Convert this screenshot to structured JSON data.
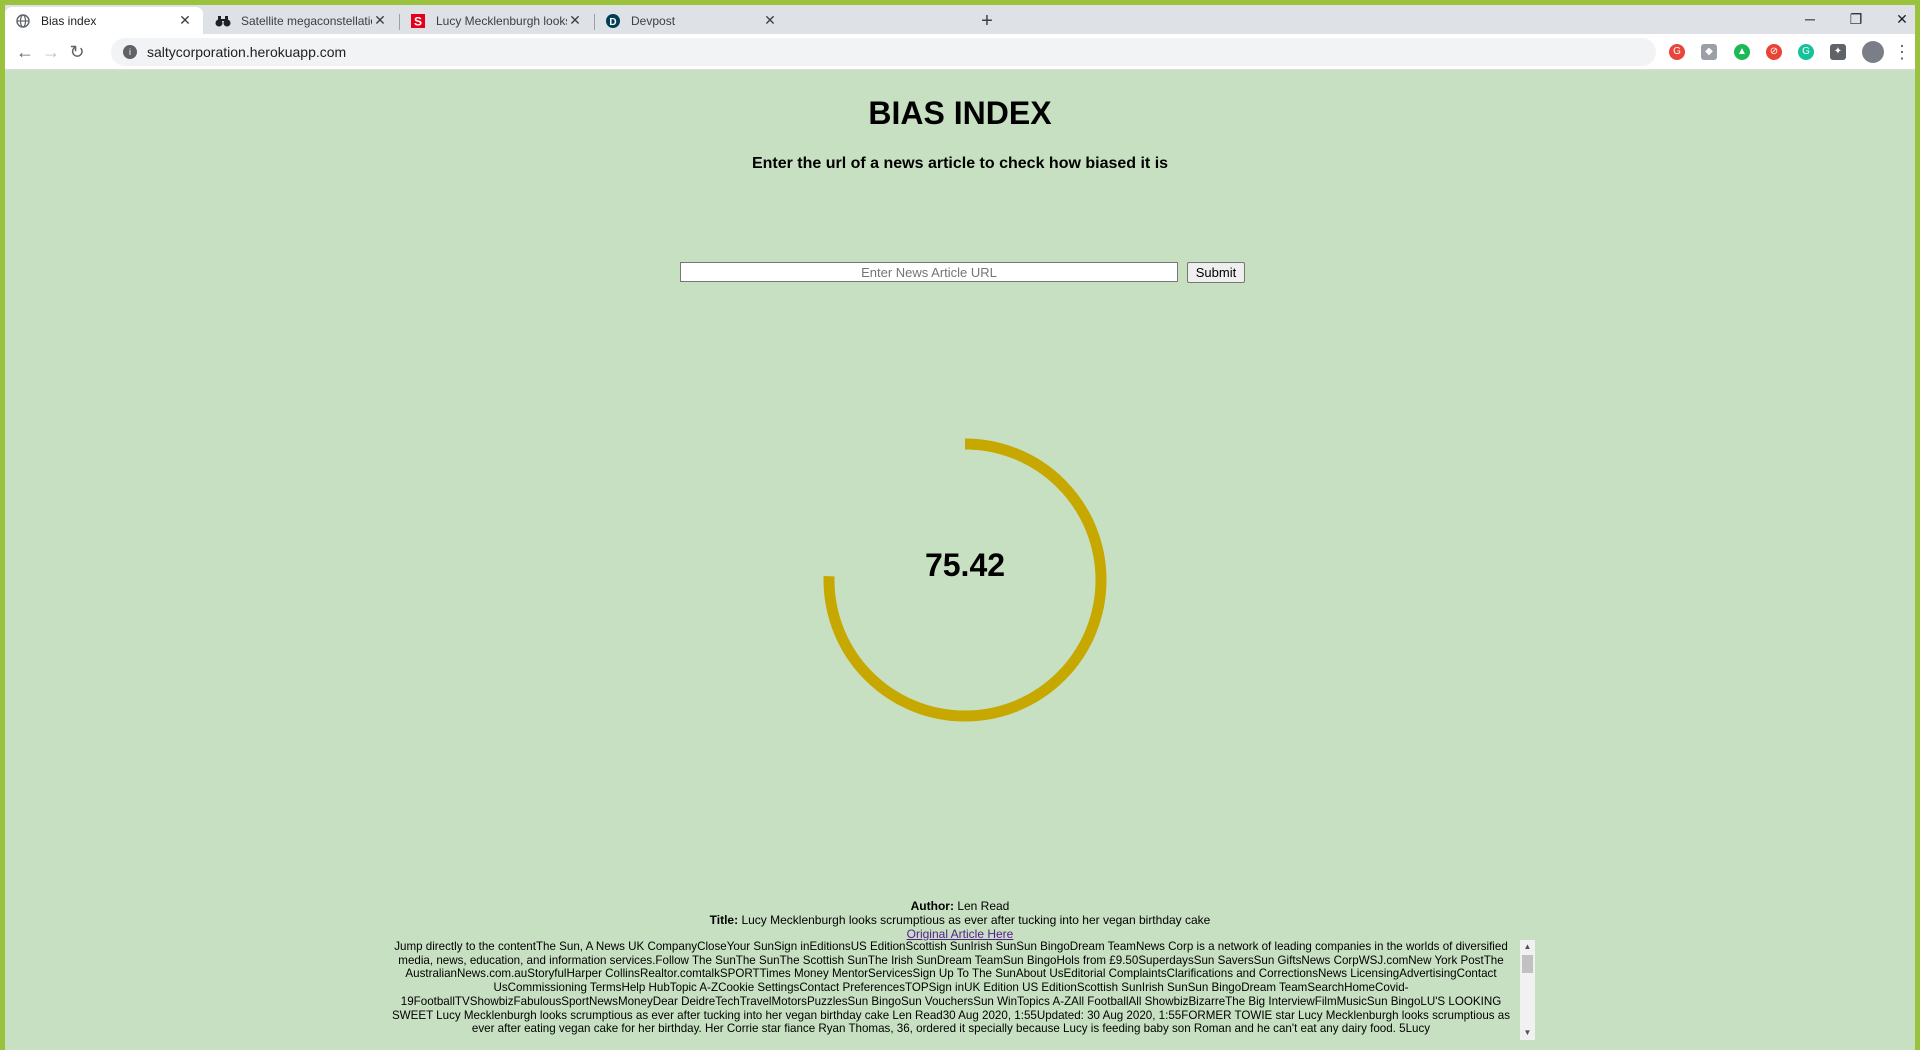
{
  "browser": {
    "tabs": [
      {
        "title": "Bias index",
        "favicon": "globe-icon",
        "active": true
      },
      {
        "title": "Satellite megaconstellations coul",
        "favicon": "binoculars-icon",
        "active": false
      },
      {
        "title": "Lucy Mecklenburgh looks scrump",
        "favicon": "sun-s-logo-icon",
        "active": false
      },
      {
        "title": "Devpost",
        "favicon": "devpost-d-icon",
        "active": false
      }
    ],
    "new_tab_label": "+",
    "address": "saltycorporation.herokuapp.com",
    "window_controls": {
      "minimize": "─",
      "restore": "❐",
      "close": "✕"
    },
    "nav": {
      "back": "←",
      "forward": "→",
      "reload": "↻",
      "menu": "⋮"
    }
  },
  "page": {
    "title": "BIAS INDEX",
    "subtitle": "Enter the url of a news article to check how biased it is",
    "url_input": {
      "placeholder": "Enter News Article URL",
      "value": ""
    },
    "submit_label": "Submit",
    "score": "75.42",
    "score_fraction": 0.7542,
    "gauge_color": "#c7a800",
    "author_label": "Author:",
    "author": "Len Read",
    "title_label": "Title:",
    "article_title": "Lucy Mecklenburgh looks scrumptious as ever after tucking into her vegan birthday cake",
    "original_link": "Original Article Here",
    "article_text": "Jump directly to the contentThe Sun, A News UK CompanyCloseYour SunSign inEditionsUS EditionScottish SunIrish SunSun BingoDream TeamNews Corp is a network of leading companies in the worlds of diversified media, news, education, and information services.Follow The SunThe SunThe Scottish SunThe Irish SunDream TeamSun BingoHols from £9.50SuperdaysSun SaversSun GiftsNews CorpWSJ.comNew York PostThe AustralianNews.com.auStoryfulHarper CollinsRealtor.comtalkSPORTTimes Money MentorServicesSign Up To The SunAbout UsEditorial ComplaintsClarifications and CorrectionsNews LicensingAdvertisingContact UsCommissioning TermsHelp HubTopic A-ZCookie SettingsContact PreferencesTOPSign inUK Edition US EditionScottish SunIrish SunSun BingoDream TeamSearchHomeCovid-19FootballTVShowbizFabulousSportNewsMoneyDear DeidreTechTravelMotorsPuzzlesSun BingoSun VouchersSun WinTopics A-ZAll FootballAll ShowbizBizarreThe Big InterviewFilmMusicSun BingoLU'S LOOKING SWEET Lucy Mecklenburgh looks scrumptious as ever after tucking into her vegan birthday cake Len Read30 Aug 2020, 1:55Updated: 30 Aug 2020, 1:55FORMER TOWIE star Lucy Mecklenburgh looks scrumptious as ever after eating vegan cake for her birthday. Her Corrie star fiance Ryan Thomas, 36, ordered it specially because Lucy is feeding baby son Roman and he can't eat any dairy food. 5Lucy"
  }
}
